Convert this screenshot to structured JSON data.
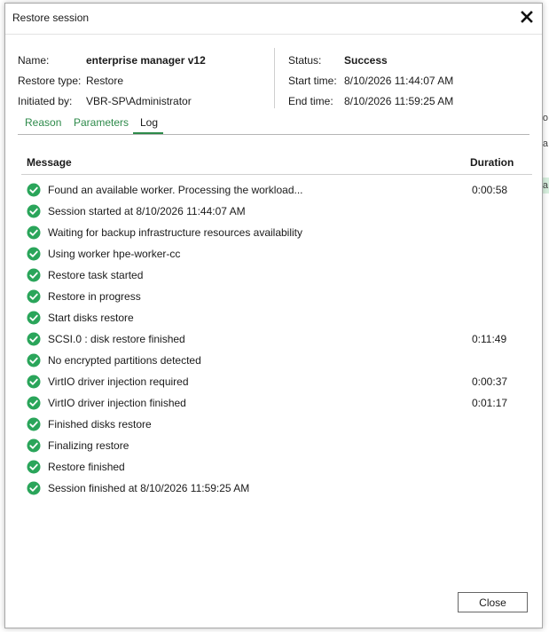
{
  "window": {
    "title": "Restore session"
  },
  "info": {
    "name_label": "Name:",
    "name_value": "enterprise manager v12",
    "restore_type_label": "Restore type:",
    "restore_type_value": "Restore",
    "initiated_by_label": "Initiated by:",
    "initiated_by_value": "VBR-SP\\Administrator",
    "status_label": "Status:",
    "status_value": "Success",
    "start_time_label": "Start time:",
    "start_time_value": "8/10/2026 11:44:07 AM",
    "end_time_label": "End time:",
    "end_time_value": "8/10/2026 11:59:25 AM"
  },
  "tabs": [
    {
      "label": "Reason"
    },
    {
      "label": "Parameters"
    },
    {
      "label": "Log"
    }
  ],
  "active_tab": "Log",
  "log": {
    "col_message": "Message",
    "col_duration": "Duration",
    "rows": [
      {
        "message": "Found an available worker. Processing the workload...",
        "duration": "0:00:58"
      },
      {
        "message": "Session started at 8/10/2026 11:44:07 AM",
        "duration": ""
      },
      {
        "message": "Waiting for backup infrastructure resources availability",
        "duration": ""
      },
      {
        "message": "Using worker hpe-worker-cc",
        "duration": ""
      },
      {
        "message": "Restore task started",
        "duration": ""
      },
      {
        "message": "Restore in progress",
        "duration": ""
      },
      {
        "message": "Start disks restore",
        "duration": ""
      },
      {
        "message": "SCSI.0 : disk restore finished",
        "duration": "0:11:49"
      },
      {
        "message": "No encrypted partitions detected",
        "duration": ""
      },
      {
        "message": "VirtIO driver injection required",
        "duration": "0:00:37"
      },
      {
        "message": "VirtIO driver injection finished",
        "duration": "0:01:17"
      },
      {
        "message": "Finished disks restore",
        "duration": ""
      },
      {
        "message": "Finalizing restore",
        "duration": ""
      },
      {
        "message": "Restore finished",
        "duration": ""
      },
      {
        "message": "Session finished at 8/10/2026 11:59:25 AM",
        "duration": ""
      }
    ]
  },
  "buttons": {
    "close_label": "Close"
  },
  "background": {
    "fragment_glyph_1": "o",
    "fragment_glyph_2": "a",
    "fragment_glyph_3": "a"
  },
  "colors": {
    "accent": "#2d8a4a",
    "success": "#2aa55a"
  },
  "icons": {
    "row_status": "success-check-icon",
    "window_close": "close-icon"
  }
}
